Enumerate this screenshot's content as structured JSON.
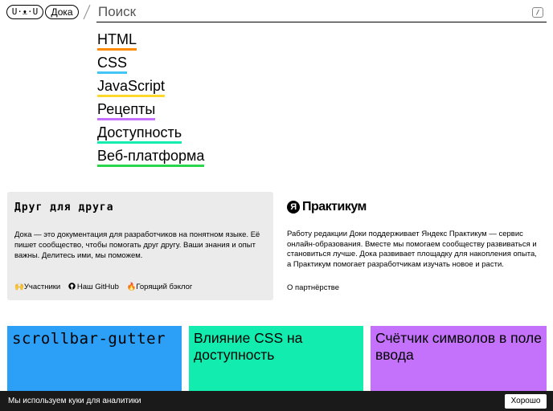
{
  "header": {
    "logo_text": "U·ᴥ·U",
    "site_label": "Дока",
    "search_placeholder": "Поиск",
    "shortcut_key": "/"
  },
  "nav": {
    "items": [
      {
        "label": "HTML",
        "color": "#ff8a00"
      },
      {
        "label": "CSS",
        "color": "#41c6f6"
      },
      {
        "label": "JavaScript",
        "color": "#ffd829"
      },
      {
        "label": "Рецепты",
        "color": "#c56fff"
      },
      {
        "label": "Доступность",
        "color": "#13ecaf"
      },
      {
        "label": "Веб-платформа",
        "color": "#29d64c"
      }
    ]
  },
  "friend": {
    "title": "Друг для друга",
    "text": "Дока — это документация для разработчиков на понятном языке. Её пишет сообщество, чтобы помогать друг другу. Ваши знания и опыт важны. Делитесь ими, мы поможем.",
    "links": [
      {
        "icon": "🙌",
        "label": "Участники"
      },
      {
        "icon": "github-icon",
        "label": "Наш GitHub"
      },
      {
        "icon": "🔥",
        "label": "Горящий бэклог"
      }
    ]
  },
  "partner": {
    "logo_letter": "Я",
    "logo_text": "Практикум",
    "text": "Работу редакции Доки поддерживает Яндекс Практикум — сервис онлайн-образования. Вместе мы помогаем сообществу развиваться и становиться лучше. Дока развивает площадку для накопления опыта, а Практикум помогает разработчикам изучать новое и расти.",
    "link": "О партнёрстве"
  },
  "cards": [
    {
      "title": "scrollbar-gutter",
      "color": "#2c9ff6"
    },
    {
      "title": "Влияние CSS на доступность",
      "color": "#13ecaf"
    },
    {
      "title": "Счётчик символов в поле ввода",
      "color": "#c472fb"
    }
  ],
  "cookie": {
    "text": "Мы используем куки для аналитики",
    "button": "Хорошо"
  }
}
